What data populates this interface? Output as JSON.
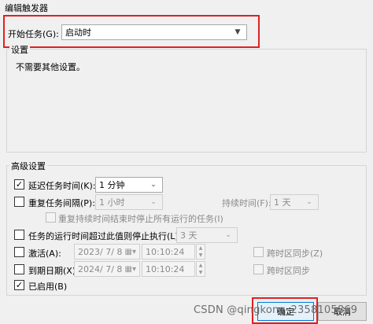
{
  "window": {
    "title": "编辑触发器"
  },
  "begin_task": {
    "label": "开始任务(G):",
    "value": "启动时"
  },
  "settings": {
    "legend": "设置",
    "text": "不需要其他设置。"
  },
  "advanced": {
    "legend": "高级设置",
    "delay": {
      "checked": true,
      "label": "延迟任务时间(K):",
      "value": "1 分钟"
    },
    "repeat": {
      "checked": false,
      "label": "重复任务间隔(P):",
      "value": "1 小时",
      "duration_label": "持续时间(F):",
      "duration_value": "1 天"
    },
    "stop_running": {
      "checked": false,
      "label": "重复持续时间结束时停止所有运行的任务(I)"
    },
    "stop_longer": {
      "checked": false,
      "label": "任务的运行时间超过此值则停止执行(L):",
      "value": "3 天"
    },
    "activate": {
      "checked": false,
      "label": "激活(A):",
      "date": "2023/ 7/ 8",
      "time": "10:10:24",
      "sync_label": "跨时区同步(Z)"
    },
    "expire": {
      "checked": false,
      "label": "到期日期(X):",
      "date": "2024/ 7/ 8",
      "time": "10:10:24",
      "sync_label": "跨时区同步"
    },
    "enabled": {
      "checked": true,
      "label": "已启用(B)"
    }
  },
  "buttons": {
    "ok": "确定",
    "cancel": "取消"
  },
  "watermark": "CSDN @qingkong_2358105869",
  "icons": {
    "dropdown": "chevron-down-icon",
    "calendar": "calendar-icon",
    "check": "checkmark-icon"
  },
  "colors": {
    "highlight": "#e02020",
    "primary_border": "#0078d7"
  }
}
